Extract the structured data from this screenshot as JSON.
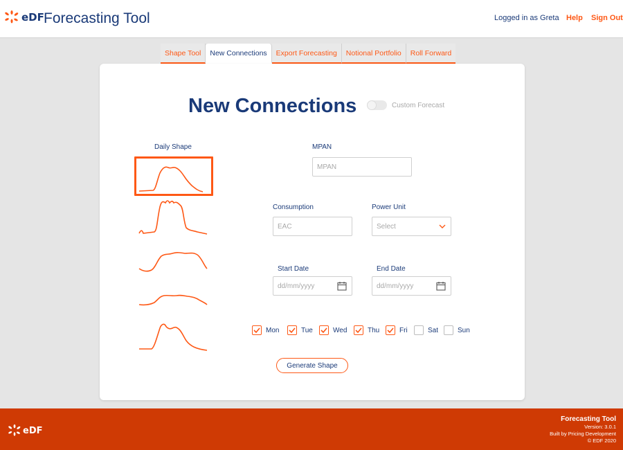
{
  "header": {
    "logo_text": "eDF",
    "app_title": "Forecasting Tool",
    "user_text": "Logged in as Greta",
    "help": "Help",
    "sign_out": "Sign Out"
  },
  "tabs": [
    {
      "label": "Shape Tool",
      "active": false
    },
    {
      "label": "New Connections",
      "active": true
    },
    {
      "label": "Export Forecasting",
      "active": false
    },
    {
      "label": "Notional Portfolio",
      "active": false
    },
    {
      "label": "Roll Forward",
      "active": false
    }
  ],
  "page": {
    "title": "New Connections",
    "custom_forecast_label": "Custom Forecast",
    "custom_forecast_on": false
  },
  "daily_shape": {
    "label": "Daily Shape",
    "selected_index": 0,
    "count": 5
  },
  "form": {
    "mpan_label": "MPAN",
    "mpan_placeholder": "MPAN",
    "consumption_label": "Consumption",
    "consumption_placeholder": "EAC",
    "power_unit_label": "Power Unit",
    "power_unit_value": "Select",
    "start_date_label": "Start Date",
    "start_date_placeholder": "dd/mm/yyyy",
    "end_date_label": "End Date",
    "end_date_placeholder": "dd/mm/yyyy"
  },
  "days": [
    {
      "label": "Mon",
      "checked": true
    },
    {
      "label": "Tue",
      "checked": true
    },
    {
      "label": "Wed",
      "checked": true
    },
    {
      "label": "Thu",
      "checked": true
    },
    {
      "label": "Fri",
      "checked": true
    },
    {
      "label": "Sat",
      "checked": false
    },
    {
      "label": "Sun",
      "checked": false
    }
  ],
  "generate_button": "Generate Shape",
  "footer": {
    "logo_text": "eDF",
    "app": "Forecasting Tool",
    "version": "Version: 3.0.1",
    "built_by": "Built by Pricing Development",
    "copyright": "© EDF 2020"
  },
  "colors": {
    "accent": "#fe5815",
    "navy": "#1a3a78",
    "footer": "#cf3a04"
  }
}
